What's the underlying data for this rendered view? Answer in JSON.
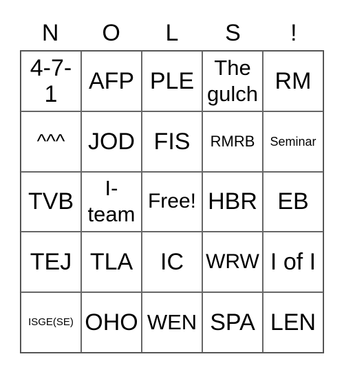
{
  "header": [
    "N",
    "O",
    "L",
    "S",
    "!"
  ],
  "cells": [
    [
      "4-7-1",
      "AFP",
      "PLE",
      "The gulch",
      "RM"
    ],
    [
      "^^^",
      "JOD",
      "FIS",
      "RMRB",
      "Seminar"
    ],
    [
      "TVB",
      "I-team",
      "Free!",
      "HBR",
      "EB"
    ],
    [
      "TEJ",
      "TLA",
      "IC",
      "WRW",
      "I of I"
    ],
    [
      "ISGE(SE)",
      "OHO",
      "WEN",
      "SPA",
      "LEN"
    ]
  ]
}
